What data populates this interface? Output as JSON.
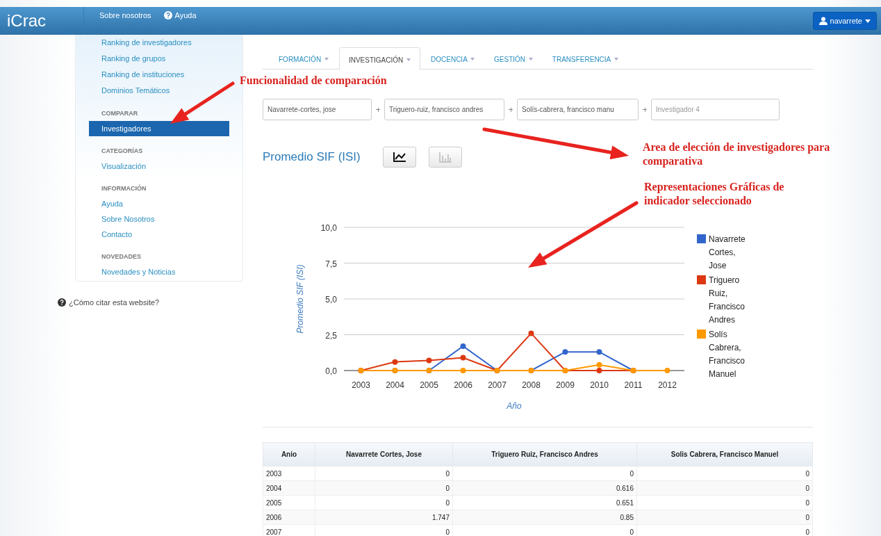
{
  "navbar": {
    "brand": "iCrac",
    "links": [
      {
        "label": "Sobre nosotros",
        "kind": "plain"
      },
      {
        "label": "Ayuda",
        "kind": "help"
      }
    ],
    "user": "navarrete"
  },
  "sidebar": {
    "sections": [
      {
        "items": [
          {
            "label": "Ranking de investigadores",
            "selected": false
          },
          {
            "label": "Ranking de grupos",
            "selected": false
          },
          {
            "label": "Ranking de instituciones",
            "selected": false
          },
          {
            "label": "Dominios Temáticos",
            "selected": false
          }
        ]
      },
      {
        "heading": "COMPARAR",
        "items": [
          {
            "label": "Investigadores",
            "selected": true
          }
        ]
      },
      {
        "heading": "CATEGORÍAS",
        "items": [
          {
            "label": "Visualización",
            "selected": false
          }
        ]
      },
      {
        "heading": "INFORMACIÓN",
        "items": [
          {
            "label": "Ayuda",
            "selected": false
          },
          {
            "label": "Sobre Nosotros",
            "selected": false
          },
          {
            "label": "Contacto",
            "selected": false
          }
        ]
      },
      {
        "heading": "NOVEDADES",
        "items": [
          {
            "label": "Novedades y Noticias",
            "selected": false
          }
        ]
      }
    ],
    "cite_link": "¿Cómo citar esta website?"
  },
  "tabs": [
    {
      "label": "FORMACIÓN",
      "selected": false
    },
    {
      "label": "INVESTIGACIÓN",
      "selected": true
    },
    {
      "label": "DOCENCIA",
      "selected": false
    },
    {
      "label": "GESTIÓN",
      "selected": false
    },
    {
      "label": "TRANSFERENCIA",
      "selected": false
    }
  ],
  "researchers": [
    {
      "value": "Navarrete-cortes, jose"
    },
    {
      "value": "Triguero-ruiz, francisco andres"
    },
    {
      "value": "Solís-cabrera, francisco manu"
    },
    {
      "placeholder": "Investigador 4"
    }
  ],
  "indicator": {
    "title": "Promedio SIF (ISI)",
    "chart_buttons": [
      {
        "kind": "line",
        "selected": true
      },
      {
        "kind": "bar",
        "selected": false
      }
    ]
  },
  "chart_data": {
    "type": "line",
    "xlabel": "Año",
    "ylabel": "Promedio SIF (ISI)",
    "categories": [
      "2003",
      "2004",
      "2005",
      "2006",
      "2007",
      "2008",
      "2009",
      "2010",
      "2011",
      "2012"
    ],
    "series": [
      {
        "name": "Navarrete Cortes, Jose",
        "color": "#3366cc",
        "marker": "circle",
        "values": [
          0,
          0,
          0,
          1.7,
          0,
          0,
          1.3,
          1.3,
          0,
          null
        ]
      },
      {
        "name": "Triguero Ruiz, Francisco Andres",
        "color": "#dc3912",
        "marker": "circle",
        "values": [
          0,
          0.6,
          0.7,
          0.9,
          0,
          2.6,
          0,
          0,
          0,
          null
        ]
      },
      {
        "name": "Solís Cabrera, Francisco Manuel",
        "color": "#ff9900",
        "marker": "circle",
        "values": [
          0,
          0,
          0,
          0,
          0,
          0,
          0,
          0.4,
          0,
          0
        ]
      }
    ],
    "grid": true,
    "legend": true,
    "ylim": [
      0,
      10
    ],
    "yticks": [
      {
        "value": 0,
        "label": "0,0"
      },
      {
        "value": 2.5,
        "label": "2,5"
      },
      {
        "value": 5,
        "label": "5,0"
      },
      {
        "value": 7.5,
        "label": "7,5"
      },
      {
        "value": 10,
        "label": "10,0"
      }
    ]
  },
  "table": {
    "columns": [
      "Anio",
      "Navarrete Cortes, Jose",
      "Triguero Ruiz, Francisco Andres",
      "Solis Cabrera, Francisco Manuel"
    ],
    "rows": [
      [
        "2003",
        "0",
        "0",
        "0"
      ],
      [
        "2004",
        "0",
        "0.616",
        "0"
      ],
      [
        "2005",
        "0",
        "0.651",
        "0"
      ],
      [
        "2006",
        "1.747",
        "0.85",
        "0"
      ],
      [
        "2007",
        "0",
        "0",
        "0"
      ]
    ]
  },
  "annotations": [
    {
      "text": "Funcionalidad de comparación"
    },
    {
      "text": "Area de elección de investigadores para comparativa"
    },
    {
      "text": "Representaciones Gráficas de indicador seleccionado"
    }
  ]
}
